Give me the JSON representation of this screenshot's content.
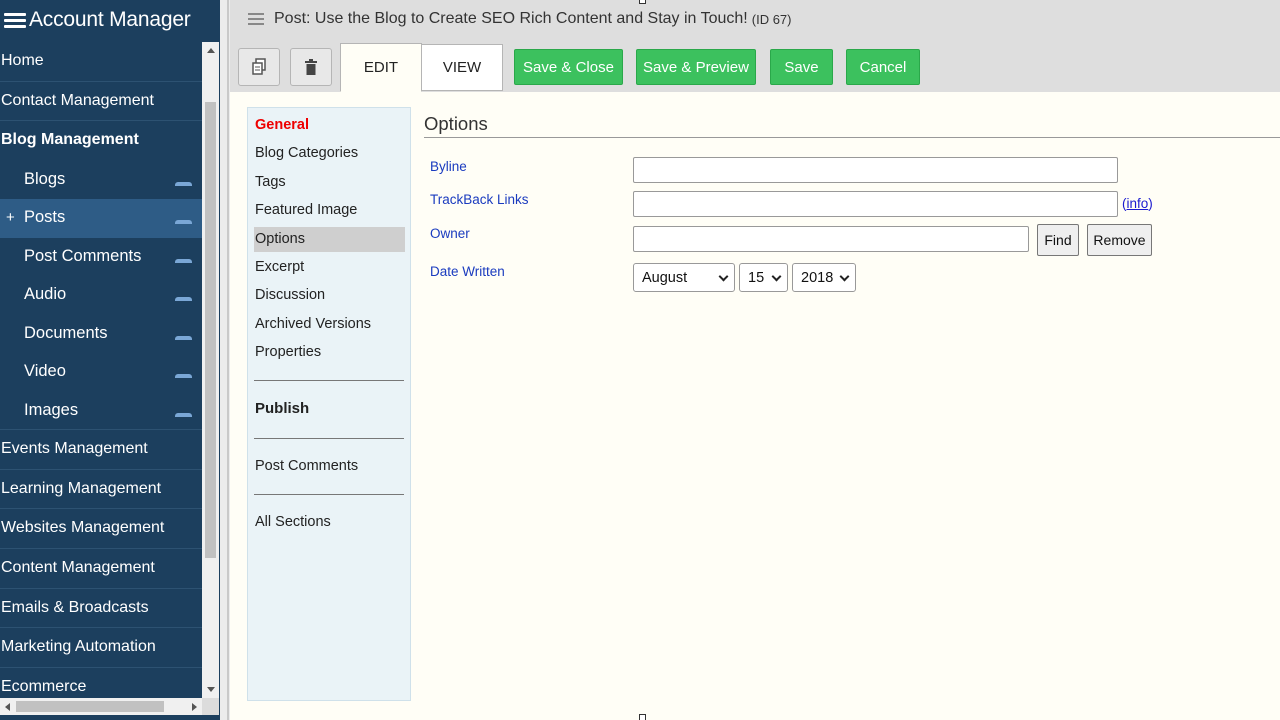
{
  "sidebar": {
    "title": "Account Manager",
    "items": [
      {
        "label": "Home"
      },
      {
        "label": "Contact Management"
      },
      {
        "label": "Blog Management"
      },
      {
        "label": "Blogs"
      },
      {
        "label": "Posts",
        "prefix": "+"
      },
      {
        "label": "Post Comments"
      },
      {
        "label": "Audio"
      },
      {
        "label": "Documents"
      },
      {
        "label": "Video"
      },
      {
        "label": "Images"
      },
      {
        "label": "Events Management"
      },
      {
        "label": "Learning Management"
      },
      {
        "label": "Websites Management"
      },
      {
        "label": "Content Management"
      },
      {
        "label": "Emails & Broadcasts"
      },
      {
        "label": "Marketing Automation"
      },
      {
        "label": "Ecommerce"
      }
    ]
  },
  "header": {
    "title": "Post: Use the Blog to Create SEO Rich Content and Stay in Touch!",
    "id_label": "(ID 67)"
  },
  "toolbar": {
    "copy_icon": "copy-icon",
    "delete_icon": "trash-icon",
    "tab_edit": "EDIT",
    "tab_view": "VIEW",
    "save_close": "Save & Close",
    "save_preview": "Save & Preview",
    "save": "Save",
    "cancel": "Cancel",
    "accent_color": "#3cc15e"
  },
  "section_menu": {
    "items": [
      "General",
      "Blog Categories",
      "Tags",
      "Featured Image",
      "Options",
      "Excerpt",
      "Discussion",
      "Archived Versions",
      "Properties"
    ],
    "publish": "Publish",
    "post_comments": "Post Comments",
    "all_sections": "All Sections",
    "selected": "Options"
  },
  "options": {
    "title": "Options",
    "byline_label": "Byline",
    "byline_value": "",
    "trackback_label": "TrackBack Links",
    "trackback_value": "",
    "info_link": "info",
    "owner_label": "Owner",
    "owner_value": "",
    "find_button": "Find",
    "remove_button": "Remove",
    "date_label": "Date Written",
    "month": "August",
    "day": "15",
    "year": "2018"
  }
}
